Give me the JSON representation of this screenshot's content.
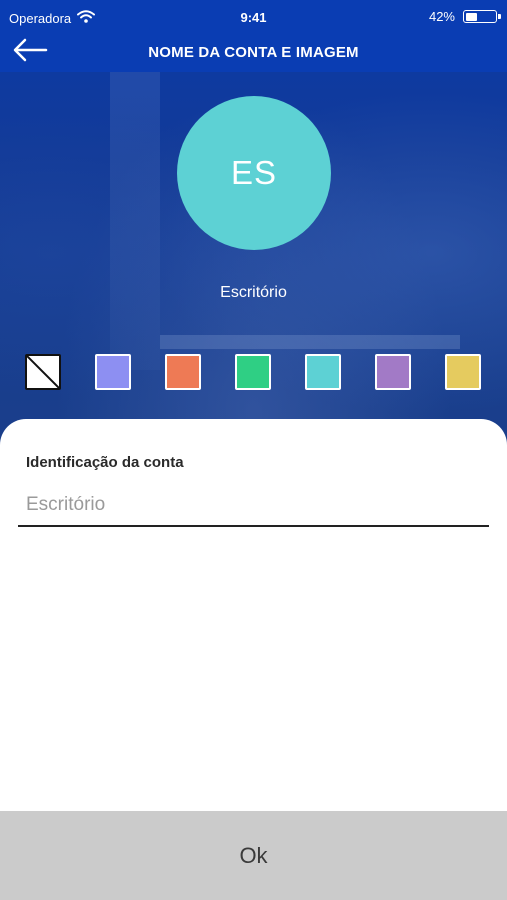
{
  "status_bar": {
    "carrier": "Operadora",
    "time": "9:41",
    "battery_percent": "42%",
    "battery_level": 0.42,
    "wifi_icon": "wifi-icon",
    "battery_icon": "battery-icon"
  },
  "nav": {
    "back_icon": "arrow-left-icon",
    "title": "NOME DA CONTA E IMAGEM"
  },
  "avatar": {
    "initials": "ES",
    "color": "#5dd1d4"
  },
  "account_name": "Escritório",
  "swatches": [
    {
      "name": "none",
      "color": "#ffffff"
    },
    {
      "name": "periwinkle",
      "color": "#8d8ff2"
    },
    {
      "name": "orange",
      "color": "#ee7a55"
    },
    {
      "name": "green",
      "color": "#2fcf84"
    },
    {
      "name": "cyan",
      "color": "#5dd1d4"
    },
    {
      "name": "purple",
      "color": "#a27ac6"
    },
    {
      "name": "yellow",
      "color": "#e5cb5f"
    }
  ],
  "form": {
    "label": "Identificação da conta",
    "placeholder": "Escritório",
    "value": ""
  },
  "ok_button": {
    "label": "Ok"
  },
  "colors": {
    "primary_blue": "#0a3db3",
    "button_gray": "#cbcbcb"
  }
}
